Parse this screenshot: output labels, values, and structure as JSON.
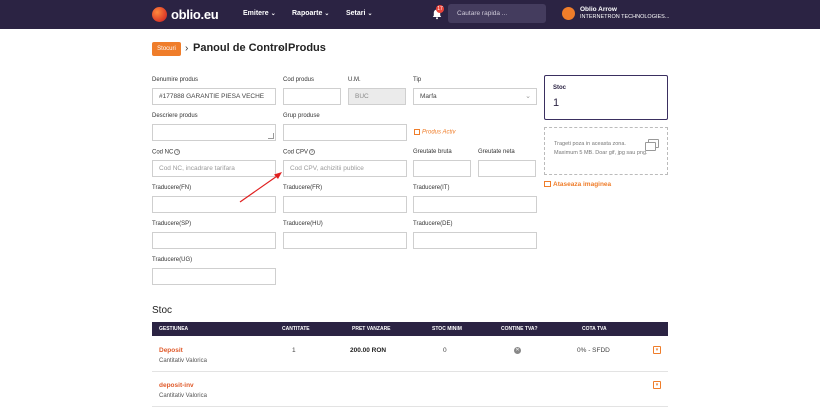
{
  "nav": {
    "logo": "oblio.eu",
    "menu": [
      {
        "label": "Emitere"
      },
      {
        "label": "Rapoarte"
      },
      {
        "label": "Setari"
      }
    ],
    "notifications": "17",
    "search_placeholder": "Cautare rapida ...",
    "user_name": "Oblio Arrow",
    "user_company": "INTERNETRON TECHNOLOGIES..."
  },
  "breadcrumb": {
    "badge": "Stocuri",
    "items": [
      "Panoul de Control",
      "Produs"
    ],
    "separator": "›"
  },
  "form": {
    "denumire_label": "Denumire produs",
    "denumire_value": "#177888 GARANTIE PIESA VECHE",
    "cod_produs_label": "Cod produs",
    "cod_produs_value": "",
    "um_label": "U.M.",
    "um_value": "BUC",
    "tip_label": "Tip",
    "tip_value": "Marfa",
    "descriere_label": "Descriere produs",
    "grup_label": "Grup produse",
    "produs_activ": "Produs Activ",
    "cod_nc_label": "Cod NC",
    "cod_nc_placeholder": "Cod NC, incadrare tarifara",
    "cod_cpv_label": "Cod CPV",
    "cod_cpv_placeholder": "Cod CPV, achizitii publice",
    "greutate_bruta_label": "Greutate bruta",
    "greutate_neta_label": "Greutate neta",
    "traduceri": {
      "fn": "Traducere(FN)",
      "fr": "Traducere(FR)",
      "it": "Traducere(IT)",
      "sp": "Traducere(SP)",
      "hu": "Traducere(HU)",
      "de": "Traducere(DE)",
      "ug": "Traducere(UG)"
    }
  },
  "stoc_box": {
    "label": "Stoc",
    "value": "1"
  },
  "upload": {
    "line1": "Trageti poza in aceasta zona.",
    "line2": "Maximum 5 MB. Doar gif, jpg sau png.",
    "attach": "Ataseaza imaginea"
  },
  "stock_table": {
    "title": "Stoc",
    "headers": [
      "GESTIUNEA",
      "CANTITATE",
      "PRET VANZARE",
      "STOC MINIM",
      "CONTINE TVA?",
      "COTA TVA"
    ],
    "rows": [
      {
        "name": "Deposit",
        "sub": "Cantitativ Valorica",
        "qty": "1",
        "price": "200.00 RON",
        "min": "0",
        "tva_icon": "x-circle-icon",
        "cota": "0% - SFDD"
      },
      {
        "name": "deposit-inv",
        "sub": "Cantitativ Valorica",
        "qty": "",
        "price": "",
        "min": "",
        "tva_icon": "",
        "cota": ""
      }
    ]
  },
  "colors": {
    "nav_bg": "#2b2343",
    "accent": "#ef7d2a",
    "arrow": "#e02020"
  }
}
